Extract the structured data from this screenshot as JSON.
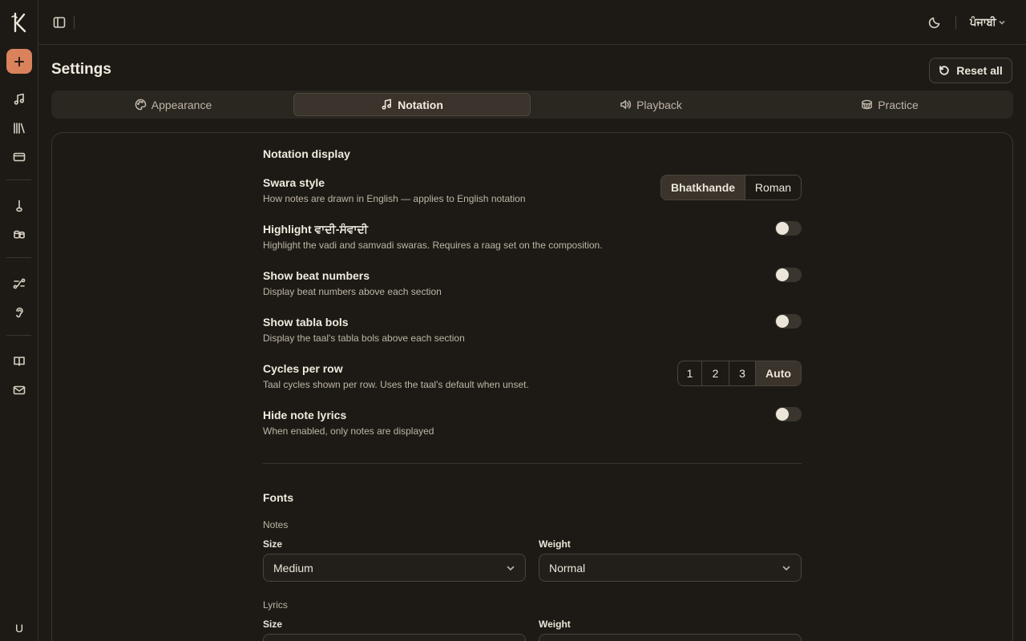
{
  "rail": {
    "logo": "K",
    "user_initial": "U",
    "items": [
      {
        "name": "music-note-icon"
      },
      {
        "name": "library-icon"
      },
      {
        "name": "card-icon"
      },
      {
        "name": "sitar-icon"
      },
      {
        "name": "tabla-icon"
      },
      {
        "name": "route-icon"
      },
      {
        "name": "ear-icon"
      },
      {
        "name": "book-icon"
      },
      {
        "name": "mail-icon"
      }
    ]
  },
  "topbar": {
    "language": "ਪੰਜਾਬੀ"
  },
  "header": {
    "title": "Settings",
    "reset_label": "Reset all"
  },
  "tabs": [
    {
      "label": "Appearance",
      "icon": "palette-icon",
      "active": false
    },
    {
      "label": "Notation",
      "icon": "music-note-icon",
      "active": true
    },
    {
      "label": "Playback",
      "icon": "volume-icon",
      "active": false
    },
    {
      "label": "Practice",
      "icon": "drum-icon",
      "active": false
    }
  ],
  "notation_display": {
    "title": "Notation display",
    "swara_style": {
      "title": "Swara style",
      "desc": "How notes are drawn in English — applies to English notation",
      "options": [
        "Bhatkhande",
        "Roman"
      ],
      "selected": "Bhatkhande"
    },
    "highlight": {
      "title": "Highlight ਵਾਦੀ-ਸੰਵਾਦੀ",
      "desc": "Highlight the vadi and samvadi swaras. Requires a raag set on the composition.",
      "on": false
    },
    "beat_numbers": {
      "title": "Show beat numbers",
      "desc": "Display beat numbers above each section",
      "on": false
    },
    "tabla_bols": {
      "title": "Show tabla bols",
      "desc": "Display the taal's tabla bols above each section",
      "on": false
    },
    "cycles": {
      "title": "Cycles per row",
      "desc": "Taal cycles shown per row. Uses the taal's default when unset.",
      "options": [
        "1",
        "2",
        "3",
        "Auto"
      ],
      "selected": "Auto"
    },
    "hide_lyrics": {
      "title": "Hide note lyrics",
      "desc": "When enabled, only notes are displayed",
      "on": false
    }
  },
  "fonts": {
    "title": "Fonts",
    "notes": {
      "label": "Notes",
      "size_label": "Size",
      "size_value": "Medium",
      "weight_label": "Weight",
      "weight_value": "Normal"
    },
    "lyrics": {
      "label": "Lyrics",
      "size_label": "Size",
      "weight_label": "Weight"
    }
  }
}
